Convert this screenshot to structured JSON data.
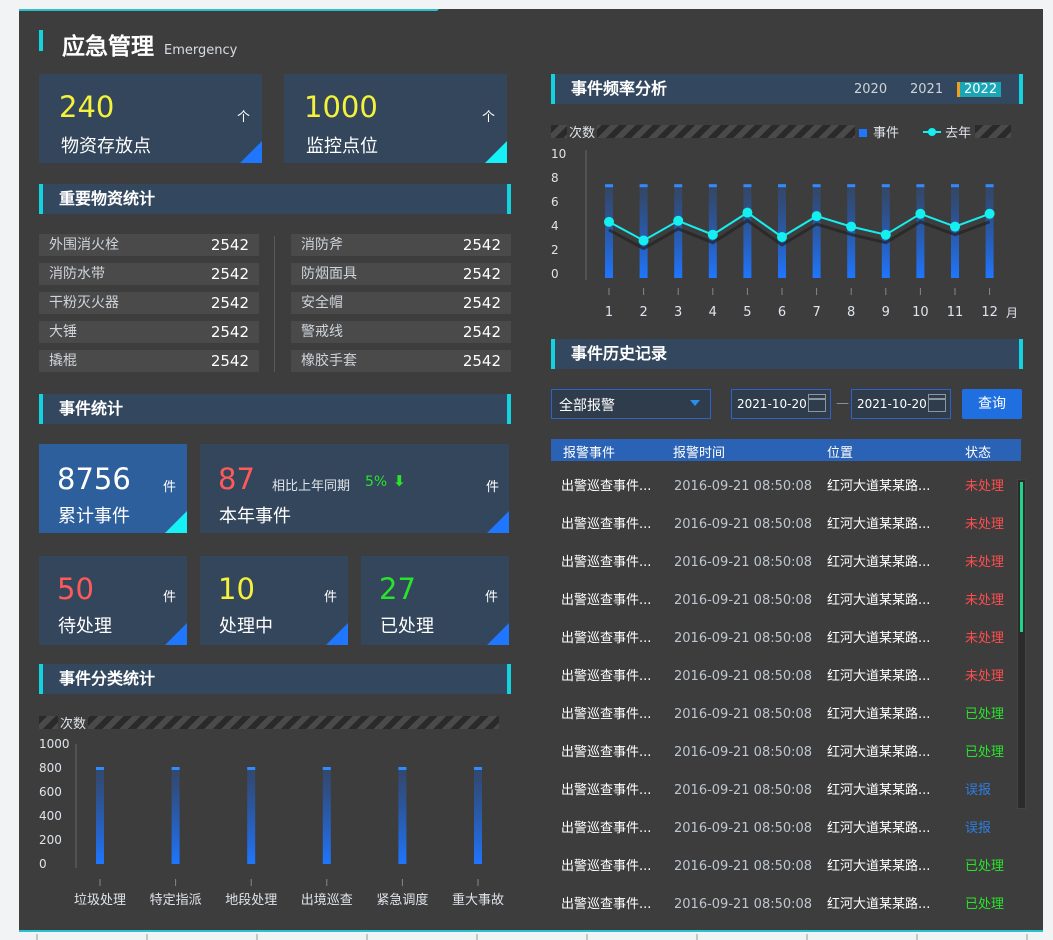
{
  "header": {
    "title": "应急管理",
    "subtitle": "Emergency"
  },
  "top_stats": [
    {
      "value": "240",
      "unit": "个",
      "label": "物资存放点"
    },
    {
      "value": "1000",
      "unit": "个",
      "label": "监控点位"
    }
  ],
  "materials": {
    "title": "重要物资统计",
    "left": [
      {
        "name": "外围消火栓",
        "value": "2542"
      },
      {
        "name": "消防水带",
        "value": "2542"
      },
      {
        "name": "干粉灭火器",
        "value": "2542"
      },
      {
        "name": "大锤",
        "value": "2542"
      },
      {
        "name": "撬棍",
        "value": "2542"
      }
    ],
    "right": [
      {
        "name": "消防斧",
        "value": "2542"
      },
      {
        "name": "防烟面具",
        "value": "2542"
      },
      {
        "name": "安全帽",
        "value": "2542"
      },
      {
        "name": "警戒线",
        "value": "2542"
      },
      {
        "name": "橡胶手套",
        "value": "2542"
      }
    ]
  },
  "events": {
    "title": "事件统计",
    "total": {
      "value": "8756",
      "unit": "件",
      "label": "累计事件"
    },
    "year": {
      "value": "87",
      "unit": "件",
      "label": "本年事件",
      "compare_label": "相比上年同期",
      "compare_value": "5%"
    },
    "pending": {
      "value": "50",
      "unit": "件",
      "label": "待处理"
    },
    "processing": {
      "value": "10",
      "unit": "件",
      "label": "处理中"
    },
    "done": {
      "value": "27",
      "unit": "件",
      "label": "已处理"
    }
  },
  "category": {
    "title": "事件分类统计"
  },
  "frequency": {
    "title": "事件频率分析",
    "years": [
      "2020",
      "2021",
      "2022"
    ],
    "selected_year": "2022"
  },
  "history": {
    "title": "事件历史记录",
    "filter": "全部报警",
    "date_from": "2021-10-20",
    "date_to": "2021-10-20",
    "dash": "—",
    "query": "查询",
    "columns": [
      "报警事件",
      "报警时间",
      "位置",
      "状态"
    ],
    "rows": [
      {
        "event": "出警巡查事件...",
        "time": "2016-09-21  08:50:08",
        "loc": "红河大道某某路...",
        "status": "未处理"
      },
      {
        "event": "出警巡查事件...",
        "time": "2016-09-21  08:50:08",
        "loc": "红河大道某某路...",
        "status": "未处理"
      },
      {
        "event": "出警巡查事件...",
        "time": "2016-09-21  08:50:08",
        "loc": "红河大道某某路...",
        "status": "未处理"
      },
      {
        "event": "出警巡查事件...",
        "time": "2016-09-21  08:50:08",
        "loc": "红河大道某某路...",
        "status": "未处理"
      },
      {
        "event": "出警巡查事件...",
        "time": "2016-09-21  08:50:08",
        "loc": "红河大道某某路...",
        "status": "未处理"
      },
      {
        "event": "出警巡查事件...",
        "time": "2016-09-21  08:50:08",
        "loc": "红河大道某某路...",
        "status": "未处理"
      },
      {
        "event": "出警巡查事件...",
        "time": "2016-09-21  08:50:08",
        "loc": "红河大道某某路...",
        "status": "已处理"
      },
      {
        "event": "出警巡查事件...",
        "time": "2016-09-21  08:50:08",
        "loc": "红河大道某某路...",
        "status": "已处理"
      },
      {
        "event": "出警巡查事件...",
        "time": "2016-09-21  08:50:08",
        "loc": "红河大道某某路...",
        "status": "误报"
      },
      {
        "event": "出警巡查事件...",
        "time": "2016-09-21  08:50:08",
        "loc": "红河大道某某路...",
        "status": "误报"
      },
      {
        "event": "出警巡查事件...",
        "time": "2016-09-21  08:50:08",
        "loc": "红河大道某某路...",
        "status": "已处理"
      },
      {
        "event": "出警巡查事件...",
        "time": "2016-09-21  08:50:08",
        "loc": "红河大道某某路...",
        "status": "已处理"
      }
    ]
  },
  "colors": {
    "accent": "#13d4de",
    "blue": "#1f76ff",
    "red": "#ff5a5a",
    "yellow": "#f4f23a",
    "green": "#29e32a",
    "status_pending": "#ff4d4d",
    "status_done": "#29e32a",
    "status_false": "#2f7de1"
  },
  "chart_data": [
    {
      "type": "bar",
      "ylabel": "次数",
      "categories": [
        "垃圾处理",
        "特定指派",
        "地段处理",
        "出境巡查",
        "紧急调度",
        "重大事故"
      ],
      "values": [
        800,
        800,
        800,
        800,
        800,
        800
      ],
      "yticks": [
        "1000",
        "800",
        "600",
        "400",
        "200",
        "0"
      ],
      "ylim": [
        0,
        1000
      ]
    },
    {
      "type": "line",
      "ylabel": "次数",
      "xlabel": "月",
      "x": [
        "1",
        "2",
        "3",
        "4",
        "5",
        "6",
        "7",
        "8",
        "9",
        "10",
        "11",
        "12"
      ],
      "yticks": [
        "10",
        "8",
        "6",
        "4",
        "2",
        "0"
      ],
      "ylim": [
        0,
        10
      ],
      "series": [
        {
          "name": "事件",
          "type": "bar",
          "values": [
            8,
            8,
            8,
            8,
            8,
            8,
            8,
            8,
            8,
            8,
            8,
            8
          ]
        },
        {
          "name": "去年",
          "type": "line",
          "values": [
            3.8,
            2.2,
            3.9,
            2.7,
            4.6,
            2.5,
            4.3,
            3.4,
            2.7,
            4.5,
            3.4,
            4.5
          ]
        }
      ],
      "legend": "top-right"
    }
  ]
}
